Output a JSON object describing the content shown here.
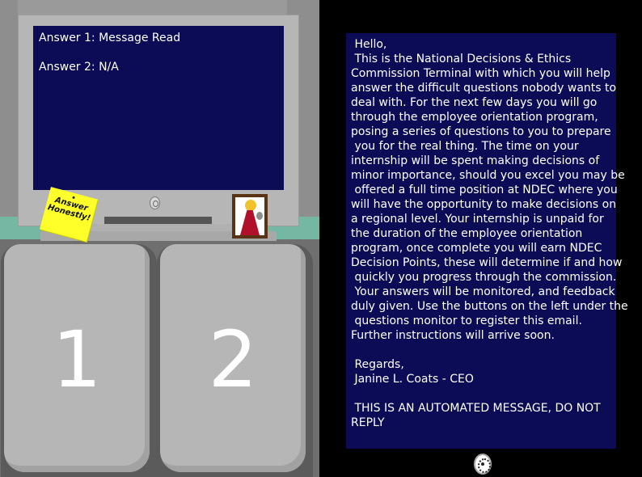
{
  "monitor": {
    "answers": [
      "Answer 1: Message Read",
      "Answer 2: N/A"
    ]
  },
  "sticky_note": {
    "text_line1": "Answer",
    "text_line2": "Honestly!"
  },
  "buttons": {
    "answer1_label": "1",
    "answer2_label": "2"
  },
  "email": {
    "lines": [
      " Hello,",
      " This is the National Decisions & Ethics",
      "Commission Terminal with which you will help",
      "answer the difficult questions nobody wants to",
      "deal with. For the next few days you will go",
      "through the employee orientation program,",
      "posing a series of questions to you to prepare",
      " you for the real thing. The time on your",
      "internship will be spent making decisions of",
      "minor importance, should you excel you may be",
      " offered a full time position at NDEC where you",
      "will have the opportunity to make decisions on",
      "a regional level. Your internship is unpaid for",
      "the duration of the employee orientation",
      "program, once complete you will earn NDEC",
      "Decision Points, these will determine if and how",
      " quickly you progress through the commission.",
      " Your answers will be monitored, and feedback",
      "duly given. Use the buttons on the left under the",
      " questions monitor to register this email.",
      "Further instructions will arrive soon.",
      "",
      " Regards,",
      " Janine L. Coats - CEO",
      "",
      " THIS IS AN AUTOMATED MESSAGE, DO NOT",
      "REPLY"
    ]
  },
  "colors": {
    "screen_bg": "#0b0c55",
    "desk_band": "#74b8a4",
    "sticky_note": "#ffff2a"
  },
  "icons": {
    "monitor_logo": "ndec-logo-icon",
    "terminal_seal": "ndec-seal-icon"
  }
}
